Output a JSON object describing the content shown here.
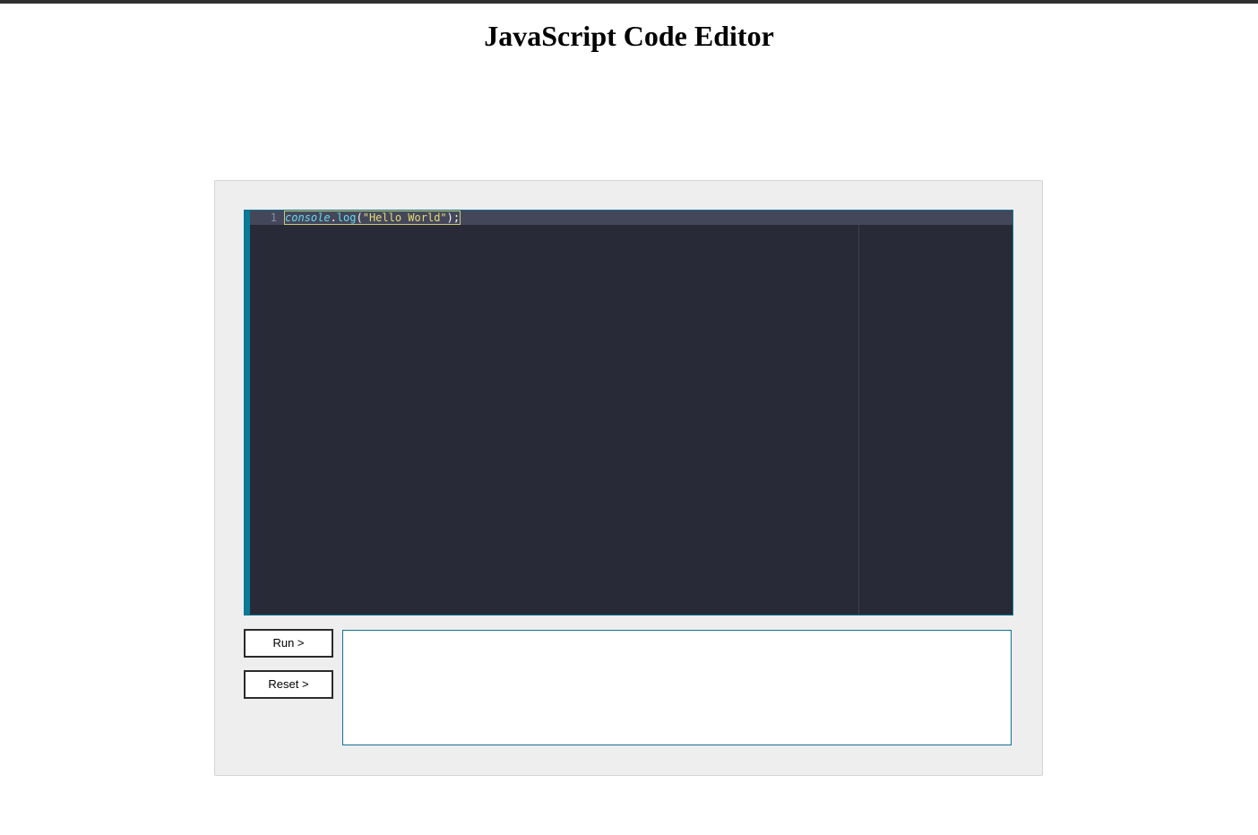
{
  "page": {
    "title": "JavaScript Code Editor"
  },
  "editor": {
    "lines": [
      {
        "number": "1",
        "tokens": {
          "object": "console",
          "dot": ".",
          "method": "log",
          "open_paren": "(",
          "string": "\"Hello World\"",
          "close": ");"
        }
      }
    ],
    "theme": {
      "background": "#292a37",
      "active_line": "#44475a",
      "accent_bar": "#0a7a96",
      "keyword_color": "#66d9ef",
      "string_color": "#e6db74"
    }
  },
  "controls": {
    "run_label": "Run >",
    "reset_label": "Reset >"
  },
  "output": {
    "text": ""
  }
}
